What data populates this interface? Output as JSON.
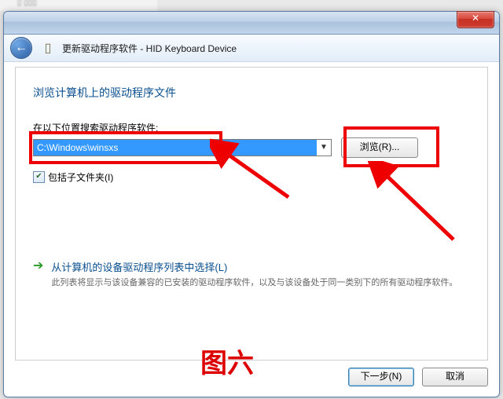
{
  "navbar": {
    "title": "更新驱动程序软件 - HID Keyboard Device"
  },
  "panel": {
    "heading": "浏览计算机上的驱动程序文件",
    "search_label": "在以下位置搜索驱动程序软件:",
    "path_value": "C:\\Windows\\winsxs",
    "browse_label": "浏览(R)...",
    "include_subfolders": "包括子文件夹(I)"
  },
  "option": {
    "title": "从计算机的设备驱动程序列表中选择(L)",
    "desc": "此列表将显示与该设备兼容的已安装的驱动程序软件，以及与该设备处于同一类别下的所有驱动程序软件。"
  },
  "footer": {
    "next": "下一步(N)",
    "cancel": "取消"
  },
  "annotation": {
    "caption": "图六"
  }
}
